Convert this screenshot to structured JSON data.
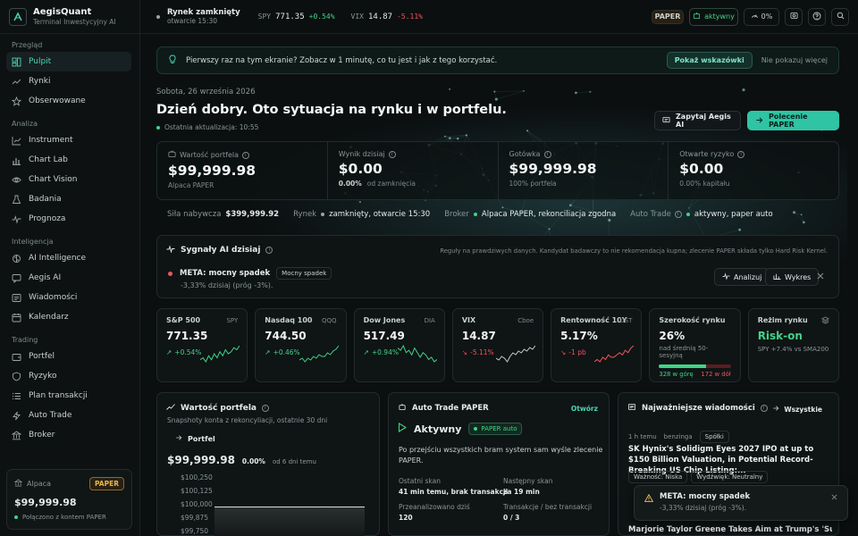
{
  "brand": {
    "name": "AegisQuant",
    "subtitle": "Terminal Inwestycyjny AI"
  },
  "market_status": {
    "title": "Rynek zamknięty",
    "subtitle": "otwarcie 15:30"
  },
  "tickers": [
    {
      "symbol": "SPY",
      "price": "771.35",
      "change": "+0.54%",
      "dir": "up"
    },
    {
      "symbol": "VIX",
      "price": "14.87",
      "change": "-5.11%",
      "dir": "down"
    }
  ],
  "topbar": {
    "paper": "PAPER",
    "active": "aktywny",
    "gauge": "0%"
  },
  "sidebar": {
    "sections": [
      {
        "label": "Przegląd",
        "items": [
          {
            "label": "Pulpit",
            "icon": "dashboard-icon",
            "active": true
          },
          {
            "label": "Rynki",
            "icon": "trend-icon"
          },
          {
            "label": "Obserwowane",
            "icon": "star-icon"
          }
        ]
      },
      {
        "label": "Analiza",
        "items": [
          {
            "label": "Instrument",
            "icon": "chart-line-icon"
          },
          {
            "label": "Chart Lab",
            "icon": "chart-bars-icon"
          },
          {
            "label": "Chart Vision",
            "icon": "eye-icon"
          },
          {
            "label": "Badania",
            "icon": "flask-icon"
          },
          {
            "label": "Prognoza",
            "icon": "pulse-icon"
          }
        ]
      },
      {
        "label": "Inteligencja",
        "items": [
          {
            "label": "AI Intelligence",
            "icon": "brain-icon"
          },
          {
            "label": "Aegis AI",
            "icon": "chat-icon"
          },
          {
            "label": "Wiadomości",
            "icon": "news-icon"
          },
          {
            "label": "Kalendarz",
            "icon": "calendar-icon"
          }
        ]
      },
      {
        "label": "Trading",
        "items": [
          {
            "label": "Portfel",
            "icon": "wallet-icon"
          },
          {
            "label": "Ryzyko",
            "icon": "shield-icon"
          },
          {
            "label": "Plan transakcji",
            "icon": "list-icon"
          },
          {
            "label": "Auto Trade",
            "icon": "bolt-icon"
          },
          {
            "label": "Broker",
            "icon": "bank-icon"
          }
        ]
      }
    ]
  },
  "account": {
    "provider": "Alpaca",
    "badge": "PAPER",
    "value": "$99,999.98",
    "status": "Połączono z kontem PAPER"
  },
  "tip": {
    "text": "Pierwszy raz na tym ekranie? Zobacz w 1 minutę, co tu jest i jak z tego korzystać.",
    "show": "Pokaż wskazówki",
    "dismiss": "Nie pokazuj więcej"
  },
  "hero": {
    "date": "Sobota, 26 września 2026",
    "title": "Dzień dobry. Oto sytuacja na rynku i w portfelu.",
    "updated": "Ostatnia aktualizacja: 10:55",
    "ask": "Zapytaj Aegis AI",
    "order": "Polecenie PAPER"
  },
  "stats": [
    {
      "label": "Wartość portfela",
      "value": "$99,999.98",
      "sub": "Alpaca PAPER"
    },
    {
      "label": "Wynik dzisiaj",
      "value": "$0.00",
      "sub_bold": "0.00%",
      "sub": "od zamknięcia"
    },
    {
      "label": "Gotówka",
      "value": "$99,999.98",
      "sub": "100% portfela"
    },
    {
      "label": "Otwarte ryzyko",
      "value": "$0.00",
      "sub": "0.00% kapitału"
    }
  ],
  "status_row": {
    "bp_label": "Siła nabywcza",
    "bp_value": "$399,999.92",
    "market_label": "Rynek",
    "market_value": "zamknięty, otwarcie 15:30",
    "broker_label": "Broker",
    "broker_value": "Alpaca PAPER, rekonciliacja zgodna",
    "auto_label": "Auto Trade",
    "auto_value": "aktywny, paper auto"
  },
  "signals": {
    "title": "Sygnały AI dzisiaj",
    "note": "Reguły na prawdziwych danych. Kandydat badawczy to nie rekomendacja kupna; zlecenie PAPER składa tylko Hard Risk Kernel.",
    "item_title": "META: mocny spadek",
    "item_tag": "Mocny spadek",
    "item_sub": "-3,33% dzisiaj (próg -3%).",
    "analyze": "Analizuj",
    "chart": "Wykres"
  },
  "market_cards": [
    {
      "name": "S&P 500",
      "ticker": "SPY",
      "value": "771.35",
      "change": "+0.54%",
      "dir": "up",
      "spark": [
        5,
        6,
        4,
        7,
        5,
        8,
        6,
        9,
        7,
        10,
        8,
        9,
        11,
        10,
        12
      ]
    },
    {
      "name": "Nasdaq 100",
      "ticker": "QQQ",
      "value": "744.50",
      "change": "+0.46%",
      "dir": "up",
      "spark": [
        4,
        5,
        3,
        5,
        4,
        6,
        5,
        7,
        6,
        6,
        8,
        7,
        9,
        10,
        12
      ]
    },
    {
      "name": "Dow Jones",
      "ticker": "DIA",
      "value": "517.49",
      "change": "+0.94%",
      "dir": "up",
      "spark": [
        10,
        9,
        11,
        8,
        9,
        7,
        10,
        8,
        6,
        8,
        7,
        5,
        6,
        4,
        5
      ]
    },
    {
      "name": "VIX",
      "ticker": "Cboe",
      "value": "14.87",
      "change": "-5.11%",
      "dir": "down",
      "spark": [
        5,
        4,
        6,
        5,
        3,
        6,
        8,
        7,
        9,
        8,
        10,
        9,
        11,
        10,
        12
      ]
    },
    {
      "name": "Rentowność 10Y",
      "ticker": "UST",
      "value": "5.17%",
      "change": "-1 pb",
      "dir": "down",
      "spark": [
        5,
        6,
        5,
        7,
        6,
        8,
        7,
        7,
        8,
        9,
        8,
        10,
        9,
        11,
        12
      ]
    }
  ],
  "breadth": {
    "title": "Szerokość rynku",
    "value": "26%",
    "sub": "nad średnią 50-sesyjną",
    "up": "328 w górę",
    "down": "172 w dół",
    "up_fraction": 0.656
  },
  "regime": {
    "title": "Reżim rynku",
    "value": "Risk-on",
    "sub": "SPY +7.4% vs SMA200"
  },
  "portfolio_panel": {
    "title": "Wartość portfela",
    "sub": "Snapshoty konta z rekoncyliacji, ostatnie 30 dni",
    "link": "Portfel",
    "value": "$99,999.98",
    "pct": "0.00%",
    "since": "od 6 dni temu",
    "y_ticks": [
      "$100,250",
      "$100,125",
      "$100,000",
      "$99,875",
      "$99,750"
    ]
  },
  "auto_panel": {
    "title": "Auto Trade PAPER",
    "open": "Otwórz",
    "status": "Aktywny",
    "badge": "PAPER auto",
    "desc": "Po przejściu wszystkich bram system sam wyśle zlecenie PAPER.",
    "last_scan_label": "Ostatni skan",
    "last_scan": "41 min temu, brak transakcji",
    "next_scan_label": "Następny skan",
    "next_scan": "za 19 min",
    "analyzed_label": "Przeanalizowano dziś",
    "analyzed": "120",
    "tx_label": "Transakcje / bez transakcji",
    "tx": "0 / 3"
  },
  "news_panel": {
    "title": "Najważniejsze wiadomości",
    "all": "Wszystkie",
    "meta1": "1 h temu",
    "meta2": "benzinga",
    "tag": "Spółki",
    "headline": "SK Hynix's Solidigm Eyes 2027 IPO at up to $150 Billion Valuation, in Potential Record-Breaking US Chip Listing:...",
    "w1": "Ważność: Niska",
    "w2": "Wydźwięk: Neutralny",
    "headline2": "Marjorie Taylor Greene Takes Aim at Trump's 'Super"
  },
  "toast": {
    "title": "META: mocny spadek",
    "sub": "-3,33% dzisiaj (próg -3%)."
  },
  "colors": {
    "accent": "#2ec4a4",
    "up": "#3fd488",
    "down": "#f0545e",
    "gold": "#e7b552"
  }
}
